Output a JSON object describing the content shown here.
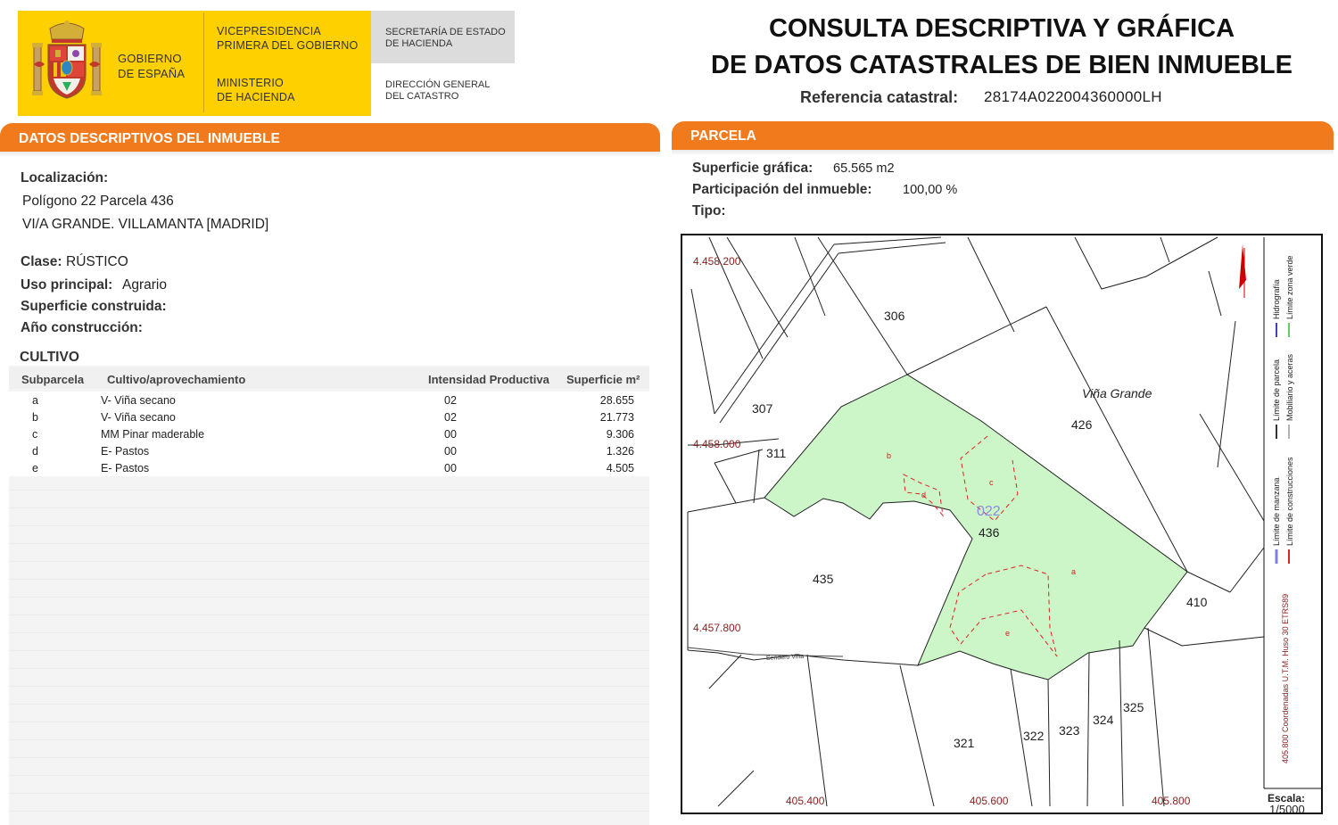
{
  "header": {
    "gobierno": [
      "GOBIERNO",
      "DE ESPAÑA"
    ],
    "vicepresidencia": [
      "VICEPRESIDENCIA",
      "PRIMERA DEL GOBIERNO"
    ],
    "ministerio": [
      "MINISTERIO",
      "DE HACIENDA"
    ],
    "secretaria": [
      "SECRETARÍA DE ESTADO",
      "DE HACIENDA"
    ],
    "direccion": [
      "DIRECCIÓN GENERAL",
      "DEL CATASTRO"
    ],
    "title_line1": "CONSULTA DESCRIPTIVA Y GRÁFICA",
    "title_line2": "DE DATOS CATASTRALES DE BIEN INMUEBLE",
    "ref_label": "Referencia catastral:",
    "ref_value": "28174A022004360000LH",
    "colors": {
      "yellow": "#fed000",
      "orange": "#f07a1c",
      "parcel_green": "#ccf5c8"
    }
  },
  "left": {
    "section_title": "DATOS DESCRIPTIVOS DEL INMUEBLE",
    "localizacion_label": "Localización:",
    "localizacion_line1": "Polígono 22 Parcela 436",
    "localizacion_line2": "VI/A GRANDE. VILLAMANTA [MADRID]",
    "clase_label": "Clase:",
    "clase_value": "RÚSTICO",
    "uso_label": "Uso principal:",
    "uso_value": "Agrario",
    "superficie_label": "Superficie construida:",
    "anio_label": "Año construcción:",
    "cultivo_title": "CULTIVO",
    "cultivo_headers": [
      "Subparcela",
      "Cultivo/aprovechamiento",
      "Intensidad Productiva",
      "Superficie m²"
    ],
    "cultivo_rows": [
      [
        "a",
        "V- Viña secano",
        "02",
        "28.655"
      ],
      [
        "b",
        "V- Viña secano",
        "02",
        "21.773"
      ],
      [
        "c",
        "MM Pinar maderable",
        "00",
        "9.306"
      ],
      [
        "d",
        "E- Pastos",
        "00",
        "1.326"
      ],
      [
        "e",
        "E- Pastos",
        "00",
        "4.505"
      ]
    ]
  },
  "right": {
    "section_title": "PARCELA",
    "sup_label": "Superficie gráfica:",
    "sup_value": "65.565 m2",
    "part_label": "Participación del inmueble:",
    "part_value": "100,00 %",
    "tipo_label": "Tipo:"
  },
  "map": {
    "parcel_numbers": [
      "306",
      "307",
      "311",
      "426",
      "435",
      "436",
      "410",
      "321",
      "322",
      "323",
      "324",
      "325"
    ],
    "place_name": "Viña Grande",
    "polygon_code": "022",
    "subparcel_letters": [
      "a",
      "b",
      "c",
      "d",
      "e"
    ],
    "coord_y": [
      "4.458.200",
      "4.458.000",
      "4.457.800"
    ],
    "coord_x": [
      "405.400",
      "405.600",
      "405.800"
    ],
    "road_label": "Sendero Viña",
    "legend": {
      "col1": [
        "Límite de manzana",
        "Límite de parcela",
        "Hidrografía"
      ],
      "col2": [
        "Límite de construcciones",
        "Mobiliario y aceras",
        "Límite zona verde"
      ],
      "utm": "405.800 Coordenadas U.T.M. Huso 30 ETRS89"
    },
    "scale_label": "Escala:",
    "scale_value": "1/5000"
  }
}
